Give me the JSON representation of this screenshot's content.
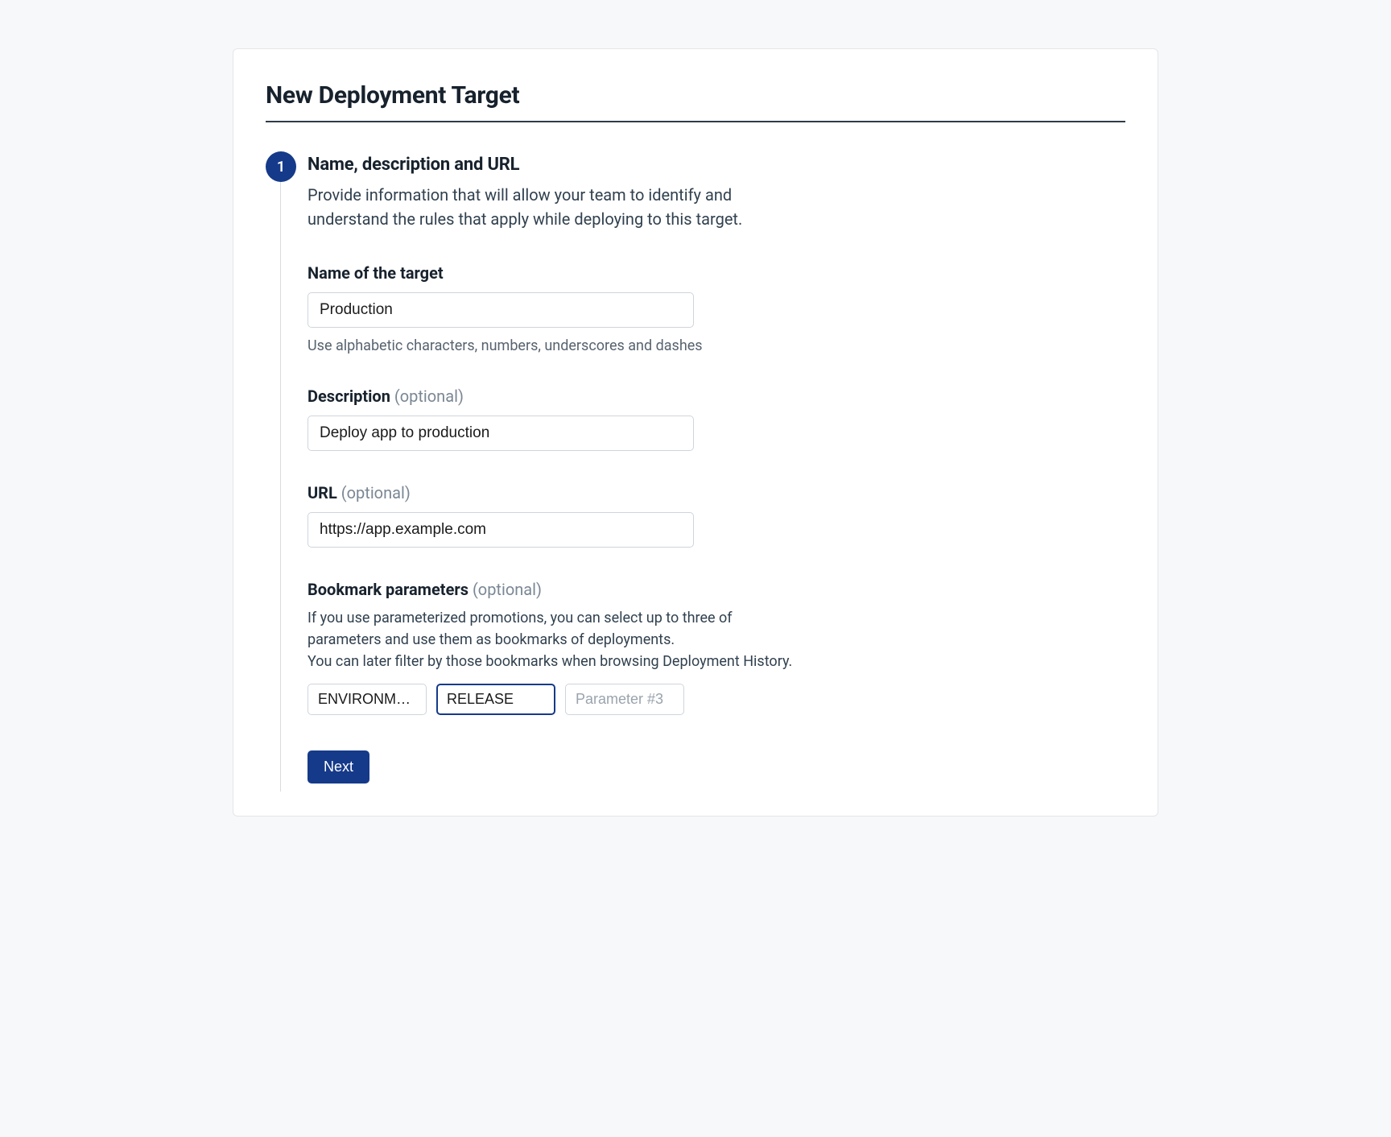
{
  "page": {
    "title": "New Deployment Target"
  },
  "step1": {
    "number": "1",
    "title": "Name, description and URL",
    "description": "Provide information that will allow your team to identify and understand the rules that apply while deploying to this target."
  },
  "name_field": {
    "label": "Name of the target",
    "value": "Production",
    "hint": "Use alphabetic characters, numbers, underscores and dashes"
  },
  "description_field": {
    "label": "Description",
    "optional": " (optional)",
    "value": "Deploy app to production"
  },
  "url_field": {
    "label": "URL",
    "optional": " (optional)",
    "value": "https://app.example.com"
  },
  "bookmark": {
    "label": "Bookmark parameters",
    "optional": " (optional)",
    "desc_line1": "If you use parameterized promotions, you can select up to three of parameters and use them as bookmarks of deployments.",
    "desc_line2": "You can later filter by those bookmarks when browsing Deployment History.",
    "params": {
      "p1": "ENVIRONMENT",
      "p2": "RELEASE",
      "p3_placeholder": "Parameter #3"
    }
  },
  "actions": {
    "next": "Next"
  }
}
